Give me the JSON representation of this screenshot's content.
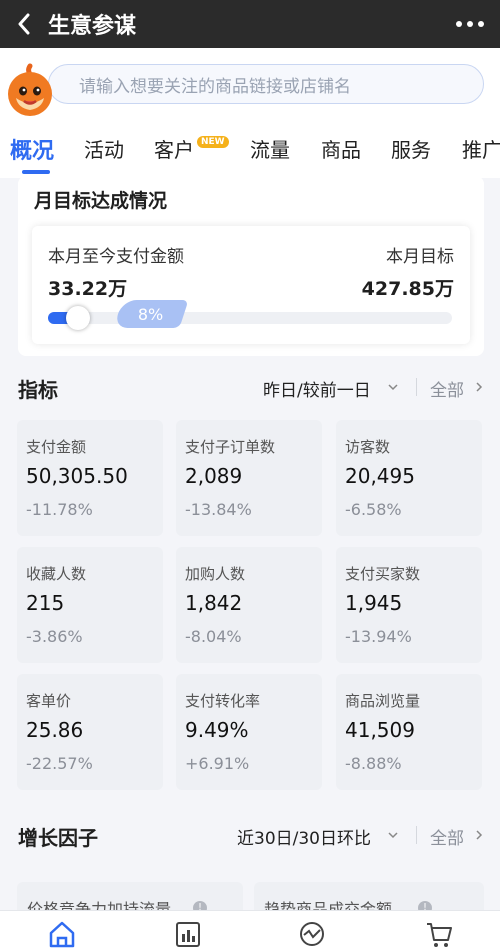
{
  "header": {
    "title": "生意参谋"
  },
  "search": {
    "placeholder": "请输入想要关注的商品链接或店铺名"
  },
  "tabs": [
    {
      "label": "概况",
      "active": true
    },
    {
      "label": "活动"
    },
    {
      "label": "客户",
      "badge": "NEW"
    },
    {
      "label": "流量"
    },
    {
      "label": "商品"
    },
    {
      "label": "服务"
    },
    {
      "label": "推广"
    }
  ],
  "goal": {
    "title": "月目标达成情况",
    "paid_label": "本月至今支付金额",
    "paid_value": "33.22万",
    "target_label": "本月目标",
    "target_value": "427.85万",
    "progress_text": "8%",
    "progress": 0.08
  },
  "metrics_section": {
    "title": "指标",
    "filter": "昨日/较前一日",
    "all": "全部",
    "items": [
      {
        "label": "支付金额",
        "value": "50,305.50",
        "change": "-11.78%"
      },
      {
        "label": "支付子订单数",
        "value": "2,089",
        "change": "-13.84%"
      },
      {
        "label": "访客数",
        "value": "20,495",
        "change": "-6.58%"
      },
      {
        "label": "收藏人数",
        "value": "215",
        "change": "-3.86%"
      },
      {
        "label": "加购人数",
        "value": "1,842",
        "change": "-8.04%"
      },
      {
        "label": "支付买家数",
        "value": "1,945",
        "change": "-13.94%"
      },
      {
        "label": "客单价",
        "value": "25.86",
        "change": "-22.57%"
      },
      {
        "label": "支付转化率",
        "value": "9.49%",
        "change": "+6.91%"
      },
      {
        "label": "商品浏览量",
        "value": "41,509",
        "change": "-8.88%"
      }
    ]
  },
  "growth_section": {
    "title": "增长因子",
    "filter": "近30日/30日环比",
    "all": "全部",
    "cards": [
      {
        "label": "价格竞争力加持流量"
      },
      {
        "label": "趋势商品成交金额"
      }
    ]
  },
  "colors": {
    "accent": "#2f6bf1",
    "titlebar": "#2b2b2b"
  }
}
